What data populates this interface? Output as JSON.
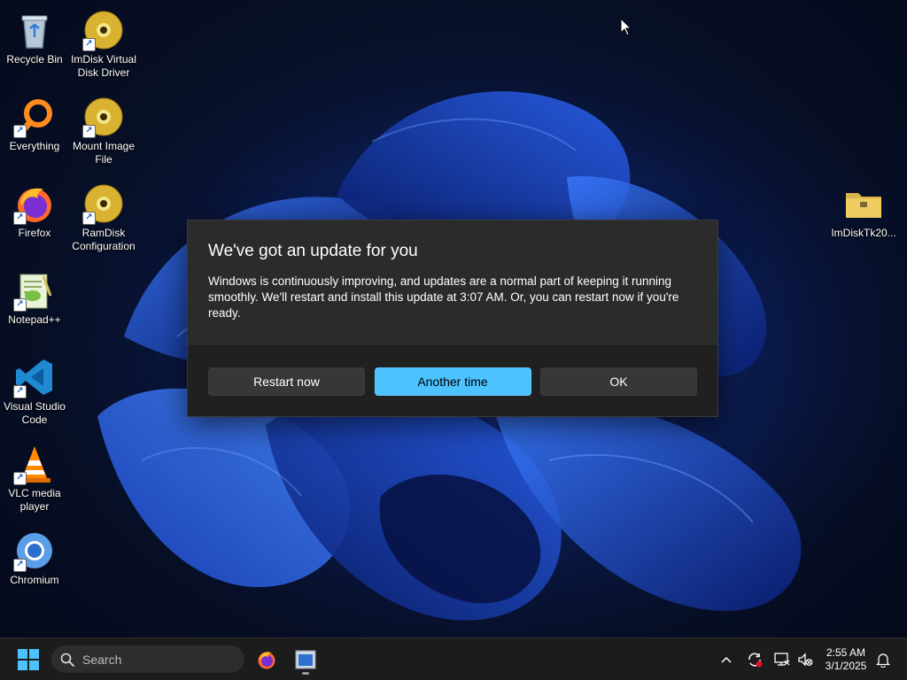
{
  "desktop_icons": [
    {
      "id": "recycle-bin",
      "label": "Recycle Bin"
    },
    {
      "id": "imdisk-virtual-disk-driver",
      "label": "ImDisk Virtual Disk Driver"
    },
    {
      "id": "everything",
      "label": "Everything"
    },
    {
      "id": "mount-image-file",
      "label": "Mount Image File"
    },
    {
      "id": "firefox",
      "label": "Firefox"
    },
    {
      "id": "ramdisk-configuration",
      "label": "RamDisk Configuration"
    },
    {
      "id": "notepad-plus-plus",
      "label": "Notepad++"
    },
    {
      "id": "visual-studio-code",
      "label": "Visual Studio Code"
    },
    {
      "id": "vlc-media-player",
      "label": "VLC media player"
    },
    {
      "id": "chromium",
      "label": "Chromium"
    },
    {
      "id": "imdisktk-folder",
      "label": "ImDiskTk20..."
    }
  ],
  "dialog": {
    "title": "We've got an update for you",
    "message": "Windows is continuously improving, and updates are a normal part of keeping it running smoothly. We'll restart and install this update at 3:07 AM. Or, you can restart now if you're ready.",
    "buttons": {
      "restart_now": "Restart now",
      "another_time": "Another time",
      "ok": "OK"
    }
  },
  "taskbar": {
    "search_placeholder": "Search",
    "clock": {
      "time": "2:55 AM",
      "date": "3/1/2025"
    }
  },
  "colors": {
    "accent": "#4cc2ff",
    "dialog_bg": "#2b2b2b",
    "dialog_footer_bg": "#202020",
    "taskbar_bg": "#1c1c1c"
  }
}
